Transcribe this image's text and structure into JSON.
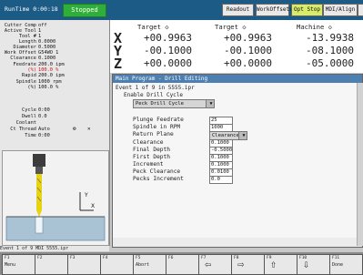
{
  "title_bar": {
    "run_time": "RunTime 0:00:18",
    "status": "Stopped",
    "buttons": [
      "Readout",
      "WorkOffsets",
      "Opt Stop",
      "MDI/Align"
    ]
  },
  "machine_info": [
    {
      "label": "Cutter Comp",
      "value": "off"
    },
    {
      "label": "Active Tool",
      "value": "1"
    },
    {
      "label": "Tool #",
      "value": "1"
    },
    {
      "label": "Length",
      "value": "0.0000"
    },
    {
      "label": "Diameter",
      "value": "0.5000"
    },
    {
      "label": "Work Offset",
      "value": "G54WO 1"
    },
    {
      "label": "Clearance",
      "value": "0.1000"
    },
    {
      "label": "Feedrate",
      "value": "200.0 ipm"
    },
    {
      "label": "(%)",
      "value": "100.0 %"
    },
    {
      "label": "Rapid",
      "value": "200.0 ipm"
    },
    {
      "label": "Spindle",
      "value": "1000 rpm"
    },
    {
      "label": "(%)",
      "value": "100.0 %"
    },
    {
      "label": "Cycle",
      "value": "0:00"
    },
    {
      "label": "Dwell",
      "value": "0.0"
    },
    {
      "label": "Coolant",
      "value": ""
    },
    {
      "label": "Ct Thread",
      "value": "Auto"
    },
    {
      "label": "Time",
      "value": "0:00"
    }
  ],
  "readout": {
    "col_heads": [
      "Target ◇",
      "Target ◇",
      "Machine ◇"
    ],
    "axes": [
      {
        "axis": "X",
        "values": [
          "+00.9963",
          "+00.9963",
          "-13.9938"
        ]
      },
      {
        "axis": "Y",
        "values": [
          "-00.1000",
          "-00.1000",
          "-08.1000"
        ]
      },
      {
        "axis": "Z",
        "values": [
          "+00.0000",
          "+00.0000",
          "-05.0000"
        ]
      }
    ]
  },
  "dialog": {
    "title": "Main Program - Drill Editing",
    "header_lines": [
      "Event 1 of 9 in 5555.ipr",
      "Enable Drill Cycle"
    ],
    "cycle_select": "Peck Drill Cycle",
    "fields": [
      {
        "label": "Plunge Feedrate",
        "value": "25"
      },
      {
        "label": "Spindle in RPM",
        "value": "1000"
      },
      {
        "label": "Return Plane",
        "value": "Clearance Plane"
      },
      {
        "label": "Clearance",
        "value": "0.1000"
      },
      {
        "label": "Final Depth",
        "value": "-0.5000"
      },
      {
        "label": "First Depth",
        "value": "0.1000"
      },
      {
        "label": "Increment",
        "value": "0.1000"
      },
      {
        "label": "Peck Clearance",
        "value": "0.0100"
      },
      {
        "label": "Pecks Increment",
        "value": "0.0"
      }
    ]
  },
  "status_line": "Event 1 of 9   MDI 5555.ipr",
  "function_keys": [
    {
      "num": "F1",
      "label": "Menu"
    },
    {
      "num": "F2",
      "label": ""
    },
    {
      "num": "F3",
      "label": ""
    },
    {
      "num": "F4",
      "label": ""
    },
    {
      "num": "F5",
      "label": "Abort"
    },
    {
      "num": "F6",
      "label": ""
    },
    {
      "num": "F7",
      "label": ""
    },
    {
      "num": "F8",
      "label": ""
    },
    {
      "num": "F9",
      "label": ""
    },
    {
      "num": "F10",
      "label": ""
    },
    {
      "num": "F11",
      "label": "Done"
    }
  ]
}
